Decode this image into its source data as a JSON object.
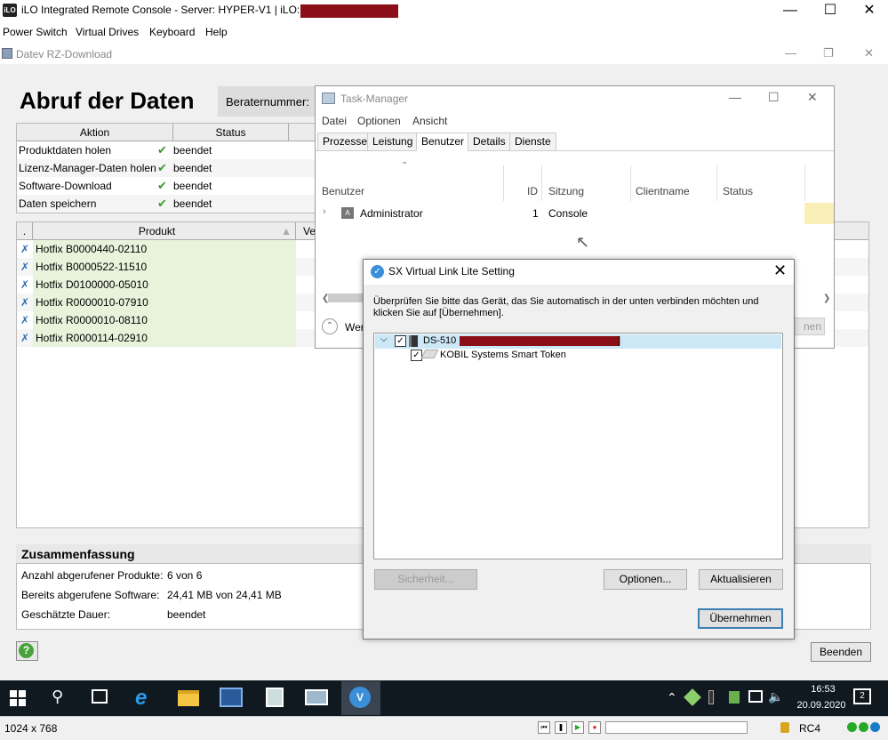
{
  "ilo": {
    "title": "iLO Integrated Remote Console - Server: HYPER-V1 | iLO: ILO",
    "logo": "iLO",
    "menu": [
      "Power Switch",
      "Virtual Drives",
      "Keyboard",
      "Help"
    ],
    "status": {
      "resolution": "1024 x 768",
      "encryption": "RC4"
    }
  },
  "datev": {
    "window_title": "Datev RZ-Download",
    "page_title": "Abruf der Daten",
    "berater_label": "Beraternummer:",
    "action_table": {
      "headers": [
        "Aktion",
        "Status"
      ],
      "rows": [
        {
          "aktion": "Produktdaten holen",
          "status": "beendet"
        },
        {
          "aktion": "Lizenz-Manager-Daten holen",
          "status": "beendet"
        },
        {
          "aktion": "Software-Download",
          "status": "beendet"
        },
        {
          "aktion": "Daten speichern",
          "status": "beendet"
        }
      ]
    },
    "product_table": {
      "headers": [
        ".",
        "Produkt",
        "Ve"
      ],
      "rows": [
        "Hotfix B0000440-02110",
        "Hotfix B0000522-11510",
        "Hotfix D0100000-05010",
        "Hotfix R0000010-07910",
        "Hotfix R0000010-08110",
        "Hotfix R0000114-02910"
      ]
    },
    "summary": {
      "title": "Zusammenfassung",
      "rows": [
        {
          "label": "Anzahl abgerufener Produkte:",
          "value": "6 von 6"
        },
        {
          "label": "Bereits abgerufene Software:",
          "value": "24,41 MB von 24,41 MB"
        },
        {
          "label": "Geschätzte Dauer:",
          "value": "beendet"
        }
      ]
    },
    "help_label": "?",
    "beenden_label": "Beenden"
  },
  "taskmgr": {
    "title": "Task-Manager",
    "menu": [
      "Datei",
      "Optionen",
      "Ansicht"
    ],
    "tabs": [
      "Prozesse",
      "Leistung",
      "Benutzer",
      "Details",
      "Dienste"
    ],
    "active_tab": "Benutzer",
    "columns": [
      "Benutzer",
      "ID",
      "Sitzung",
      "Clientname",
      "Status"
    ],
    "row": {
      "user": "Administrator",
      "id": "1",
      "session": "Console"
    },
    "footer_partial": "Wer",
    "button_partial": "nen"
  },
  "sx": {
    "title": "SX Virtual Link Lite Setting",
    "description": "Überprüfen Sie bitte das Gerät, das Sie automatisch in der unten verbinden möchten und klicken Sie auf [Übernehmen].",
    "device": "DS-510 [",
    "device_end": "]",
    "token": "KOBIL Systems Smart Token",
    "buttons": {
      "security": "Sicherheit...",
      "options": "Optionen...",
      "refresh": "Aktualisieren",
      "apply": "Übernehmen"
    }
  },
  "taskbar": {
    "time": "16:53",
    "date": "20.09.2020",
    "notifications": "2"
  }
}
